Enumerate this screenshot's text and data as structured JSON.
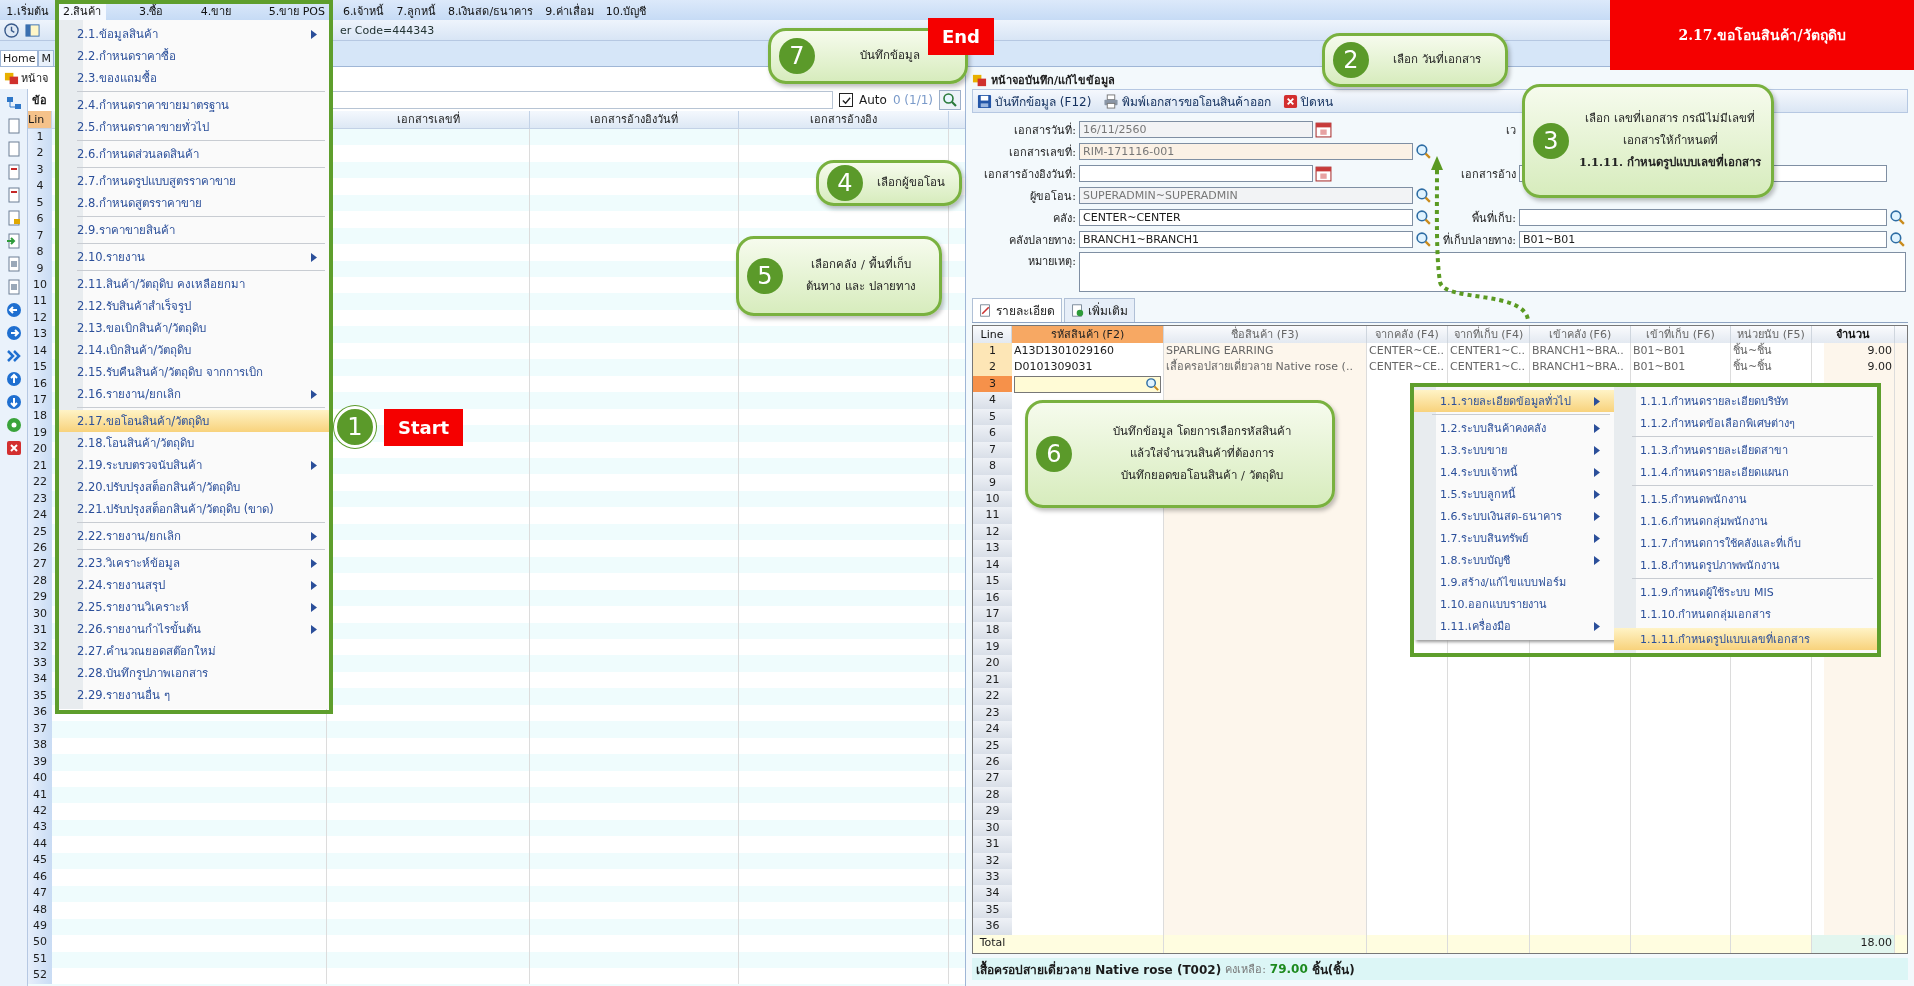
{
  "menu_bar": [
    {
      "label": "1.เริ่มต้น",
      "selected": false
    },
    {
      "label": "2.สินค้า",
      "selected": true
    },
    {
      "label": "3.ซื้อ",
      "selected": false
    },
    {
      "label": "4.ขาย",
      "selected": false
    },
    {
      "label": "5.ขาย POS",
      "selected": false
    },
    {
      "label": "6.เจ้าหนี้",
      "selected": false
    },
    {
      "label": "7.ลูกหนี้",
      "selected": false
    },
    {
      "label": "8.เงินสด/ธนาคาร",
      "selected": false
    },
    {
      "label": "9.ค่าเสื่อม",
      "selected": false
    },
    {
      "label": "10.บัญชี",
      "selected": false
    }
  ],
  "banner": "2.17.ขอโอนสินค้า/วัตถุดิบ",
  "user_code": "er Code=444343",
  "doc_tabs": [
    {
      "label": "Home",
      "selected": true
    },
    {
      "label": "M",
      "selected": false
    }
  ],
  "left_panel": {
    "title": "หน้าจ",
    "subtitle": "ข้อ",
    "auto": {
      "label": "Auto",
      "checked": true
    },
    "count": "0 (1/1)",
    "columns": [
      "Lin",
      null,
      "เอกสารเลขที่",
      "เอกสารอ้างอิงวันที่",
      "เอกสารอ้างอิง"
    ],
    "line_numbers": [
      "1",
      "2",
      "3",
      "4",
      "5",
      "6",
      "7",
      "8",
      "9",
      "10",
      "11",
      "12",
      "13",
      "14",
      "15",
      "16",
      "17",
      "18",
      "19",
      "20",
      "21",
      "22",
      "23",
      "24",
      "25",
      "26",
      "27",
      "28",
      "29",
      "30",
      "31",
      "32",
      "33",
      "34",
      "35",
      "36",
      "37",
      "38",
      "39",
      "40",
      "41",
      "42",
      "43",
      "44",
      "45",
      "46",
      "47",
      "48",
      "49",
      "50",
      "51",
      "52"
    ]
  },
  "product_menu": [
    [
      {
        "label": "2.1.ข้อมูลสินค้า",
        "arrow": true,
        "selected": false
      },
      {
        "label": "2.2.กำหนดราคาซื้อ",
        "arrow": false,
        "selected": false
      },
      {
        "label": "2.3.ของแถมซื้อ",
        "arrow": false,
        "selected": false
      }
    ],
    [
      {
        "label": "2.4.กำหนดราคาขายมาตรฐาน",
        "arrow": false,
        "selected": false
      },
      {
        "label": "2.5.กำหนดราคาขายทั่วไป",
        "arrow": false,
        "selected": false
      }
    ],
    [
      {
        "label": "2.6.กำหนดส่วนลดสินค้า",
        "arrow": false,
        "selected": false
      }
    ],
    [
      {
        "label": "2.7.กำหนดรูปแบบสูตรราคาขาย",
        "arrow": false,
        "selected": false
      },
      {
        "label": "2.8.กำหนดสูตรราคาขาย",
        "arrow": false,
        "selected": false
      }
    ],
    [
      {
        "label": "2.9.ราคาขายสินค้า",
        "arrow": false,
        "selected": false
      }
    ],
    [
      {
        "label": "2.10.รายงาน",
        "arrow": true,
        "selected": false
      }
    ],
    [
      {
        "label": "2.11.สินค้า/วัตถุดิบ คงเหลือยกมา",
        "arrow": false,
        "selected": false
      },
      {
        "label": "2.12.รับสินค้าสำเร็จรูป",
        "arrow": false,
        "selected": false
      },
      {
        "label": "2.13.ขอเบิกสินค้า/วัตถุดิบ",
        "arrow": false,
        "selected": false
      },
      {
        "label": "2.14.เบิกสินค้า/วัตถุดิบ",
        "arrow": false,
        "selected": false
      },
      {
        "label": "2.15.รับคืนสินค้า/วัตถุดิบ จากการเบิก",
        "arrow": false,
        "selected": false
      },
      {
        "label": "2.16.รายงาน/ยกเลิก",
        "arrow": true,
        "selected": false
      }
    ],
    [
      {
        "label": "2.17.ขอโอนสินค้า/วัตถุดิบ",
        "arrow": false,
        "selected": true
      },
      {
        "label": "2.18.โอนสินค้า/วัตถุดิบ",
        "arrow": false,
        "selected": false
      },
      {
        "label": "2.19.ระบบตรวจนับสินค้า",
        "arrow": true,
        "selected": false
      },
      {
        "label": "2.20.ปรับปรุงสต็อกสินค้า/วัตถุดิบ",
        "arrow": false,
        "selected": false
      },
      {
        "label": "2.21.ปรับปรุงสต็อกสินค้า/วัตถุดิบ (ขาด)",
        "arrow": false,
        "selected": false
      }
    ],
    [
      {
        "label": "2.22.รายงาน/ยกเลิก",
        "arrow": true,
        "selected": false
      }
    ],
    [
      {
        "label": "2.23.วิเคราะห์ข้อมูล",
        "arrow": true,
        "selected": false
      },
      {
        "label": "2.24.รายงานสรุป",
        "arrow": true,
        "selected": false
      },
      {
        "label": "2.25.รายงานวิเคราะห์",
        "arrow": true,
        "selected": false
      },
      {
        "label": "2.26.รายงานกำไรขั้นต้น",
        "arrow": true,
        "selected": false
      },
      {
        "label": "2.27.คำนวณยอดสต๊อกใหม่",
        "arrow": false,
        "selected": false
      },
      {
        "label": "2.28.บันทึกรูปภาพเอกสาร",
        "arrow": false,
        "selected": false
      },
      {
        "label": "2.29.รายงานอื่น ๆ",
        "arrow": false,
        "selected": false
      }
    ]
  ],
  "form": {
    "title": "หน้าจอบันทึก/แก้ไขข้อมูล",
    "toolbar": [
      "บันทึกข้อมูล (F12)",
      "พิมพ์เอกสารขอโอนสินค้าออก",
      "ปิดหน"
    ],
    "fields": [
      {
        "label": "เอกสารวันที่:",
        "value": "16/11/2560",
        "kind": "date",
        "disabled": true
      },
      {
        "label": "เอกสารเลขที่:",
        "value": "RIM-171116-001",
        "kind": "lookup",
        "disabled": true
      },
      {
        "label": "เอกสารอ้างอิงวันที่:",
        "kind": "date",
        "disabled": false
      },
      {
        "label": "ผู้ขอโอน:",
        "value": "SUPERADMIN~SUPERADMIN",
        "kind": "lookup",
        "disabled": true
      },
      {
        "label": "คลัง:",
        "value": "CENTER~CENTER",
        "kind": "lookup",
        "disabled": false
      },
      {
        "label": "คลังปลายทาง:",
        "value": "BRANCH1~BRANCH1",
        "kind": "lookup",
        "disabled": false
      }
    ],
    "right_fields": [
      {
        "label": "เว",
        "kind": "none"
      },
      {
        "kind": "none"
      },
      {
        "label": "เอกสารอ้าง",
        "kind": "text"
      },
      {
        "kind": "none"
      },
      {
        "label": "พื้นที่เก็บ:",
        "kind": "lookup"
      },
      {
        "label": "ที่เก็บปลายทาง:",
        "kind": "lookup",
        "value": "B01~B01"
      }
    ],
    "note_label": "หมายเหตุ:",
    "tabs": [
      {
        "label": "รายละเอียด",
        "selected": true
      },
      {
        "label": "เพิ่มเติม",
        "selected": false
      }
    ]
  },
  "grid": {
    "line_header": "Line",
    "columns": [
      "รหัสสินค้า (F2)",
      "ชื่อสินค้า (F3)",
      "จากคลัง (F4)",
      "จากที่เก็บ (F4)",
      "เข้าคลัง (F6)",
      "เข้าที่เก็บ (F6)",
      "หน่วยนับ (F5)",
      "จำนวน"
    ],
    "rows": [
      {
        "line": "1",
        "selected": false,
        "cells": [
          "A13D1301029160",
          "SPARLING EARRING",
          "CENTER~CE..",
          "CENTER1~C..",
          "BRANCH1~BRA..",
          "B01~B01",
          "ชิ้น~ชิ้น",
          "9.00"
        ]
      },
      {
        "line": "2",
        "selected": false,
        "cells": [
          "D0101309031",
          "เสื้อครอปสายเดี่ยวลาย Native rose (..",
          "CENTER~CE..",
          "CENTER1~C..",
          "BRANCH1~BRA..",
          "B01~B01",
          "ชิ้น~ชิ้น",
          "9.00"
        ]
      },
      {
        "line": "3",
        "selected": true
      },
      {
        "line": "4",
        "selected": false
      },
      {
        "line": "5",
        "selected": false
      },
      {
        "line": "6",
        "selected": false
      },
      {
        "line": "7",
        "selected": false
      },
      {
        "line": "8",
        "selected": false
      },
      {
        "line": "9",
        "selected": false
      },
      {
        "line": "10",
        "selected": false
      },
      {
        "line": "11",
        "selected": false
      },
      {
        "line": "12",
        "selected": false
      },
      {
        "line": "13",
        "selected": false
      },
      {
        "line": "14",
        "selected": false
      },
      {
        "line": "15",
        "selected": false
      },
      {
        "line": "16",
        "selected": false
      },
      {
        "line": "17",
        "selected": false
      },
      {
        "line": "18",
        "selected": false
      },
      {
        "line": "19",
        "selected": false
      },
      {
        "line": "20",
        "selected": false
      },
      {
        "line": "21",
        "selected": false
      },
      {
        "line": "22",
        "selected": false
      },
      {
        "line": "23",
        "selected": false
      },
      {
        "line": "24",
        "selected": false
      },
      {
        "line": "25",
        "selected": false
      },
      {
        "line": "26",
        "selected": false
      },
      {
        "line": "27",
        "selected": false
      },
      {
        "line": "28",
        "selected": false
      },
      {
        "line": "29",
        "selected": false
      },
      {
        "line": "30",
        "selected": false
      },
      {
        "line": "31",
        "selected": false
      },
      {
        "line": "32",
        "selected": false
      },
      {
        "line": "33",
        "selected": false
      },
      {
        "line": "34",
        "selected": false
      },
      {
        "line": "35",
        "selected": false
      },
      {
        "line": "36",
        "selected": false
      }
    ],
    "total_label": "Total",
    "total": "18.00"
  },
  "status": {
    "product": "เสื้อครอปสายเดี่ยวลาย Native rose (T002)",
    "remain_label": "คงเหลือ:",
    "remain": "79.00",
    "unit": "ชิ้น(ชิ้น)"
  },
  "settings_menu": [
    [
      {
        "label": "1.1.รายละเอียดข้อมูลทั่วไป",
        "arrow": true,
        "selected": true
      }
    ],
    [
      {
        "label": "1.2.ระบบสินค้าคงคลัง",
        "arrow": true,
        "selected": false
      },
      {
        "label": "1.3.ระบบขาย",
        "arrow": true,
        "selected": false
      },
      {
        "label": "1.4.ระบบเจ้าหนี้",
        "arrow": true,
        "selected": false
      },
      {
        "label": "1.5.ระบบลูกหนี้",
        "arrow": true,
        "selected": false
      },
      {
        "label": "1.6.ระบบเงินสด-ธนาคาร",
        "arrow": true,
        "selected": false
      },
      {
        "label": "1.7.ระบบสินทรัพย์",
        "arrow": true,
        "selected": false
      },
      {
        "label": "1.8.ระบบบัญชี",
        "arrow": true,
        "selected": false
      },
      {
        "label": "1.9.สร้าง/แก้ไขแบบฟอร์ม",
        "arrow": false,
        "selected": false
      },
      {
        "label": "1.10.ออกแบบรายงาน",
        "arrow": false,
        "selected": false
      },
      {
        "label": "1.11.เครื่องมือ",
        "arrow": true,
        "selected": false
      }
    ]
  ],
  "settings_submenu": [
    [
      {
        "label": "1.1.1.กำหนดรายละเอียดบริษัท",
        "selected": false
      },
      {
        "label": "1.1.2.กำหนดข้อเลือกพิเศษต่างๆ",
        "selected": false
      }
    ],
    [
      {
        "label": "1.1.3.กำหนดรายละเอียดสาขา",
        "selected": false
      },
      {
        "label": "1.1.4.กำหนดรายละเอียดแผนก",
        "selected": false
      }
    ],
    [
      {
        "label": "1.1.5.กำหนดพนักงาน",
        "selected": false
      },
      {
        "label": "1.1.6.กำหนดกลุ่มพนักงาน",
        "selected": false
      },
      {
        "label": "1.1.7.กำหนดการใช้คลังและที่เก็บ",
        "selected": false
      },
      {
        "label": "1.1.8.กำหนดรูปภาพพนักงาน",
        "selected": false
      }
    ],
    [
      {
        "label": "1.1.9.กำหนดผู้ใช้ระบบ MIS",
        "selected": false
      },
      {
        "label": "1.1.10.กำหนดกลุ่มเอกสาร",
        "selected": false
      }
    ],
    [
      {
        "label": "1.1.11.กำหนดรูปแบบเลขที่เอกสาร",
        "selected": true
      }
    ]
  ],
  "steps": [
    {
      "number": "7",
      "kind": "bubble",
      "lines": [
        "บันทึกข้อมูล"
      ]
    },
    {
      "number": "2",
      "kind": "bubble",
      "lines": [
        "เลือก วันที่เอกสาร"
      ]
    },
    {
      "number": "3",
      "kind": "bubble",
      "lines": [
        "เลือก เลขที่เอกสาร  กรณีไม่มีเลขที่",
        "เอกสารให้กำหนดที่",
        "**1.1.11. กำหนดรูปแบบเลขที่เอกสาร**"
      ]
    },
    {
      "number": "4",
      "kind": "bubble",
      "lines": [
        "เลือกผู้ขอโอน"
      ]
    },
    {
      "number": "5",
      "kind": "bubble",
      "lines": [
        "เลือกคลัง / พื้นที่เก็บ",
        "ต้นทาง และ ปลายทาง"
      ]
    },
    {
      "number": "1",
      "kind": "badge",
      "lines": [
        "Start"
      ]
    },
    {
      "number": "6",
      "kind": "bubble",
      "lines": [
        "บันทึกข้อมูล โดยการเลือกรหัสสินค้า",
        "แล้วใส่จำนวนสินค้าที่ต้องการ",
        "บันทึกยอดขอโอนสินค้า / วัตถุดิบ"
      ]
    }
  ],
  "end_label": "End"
}
